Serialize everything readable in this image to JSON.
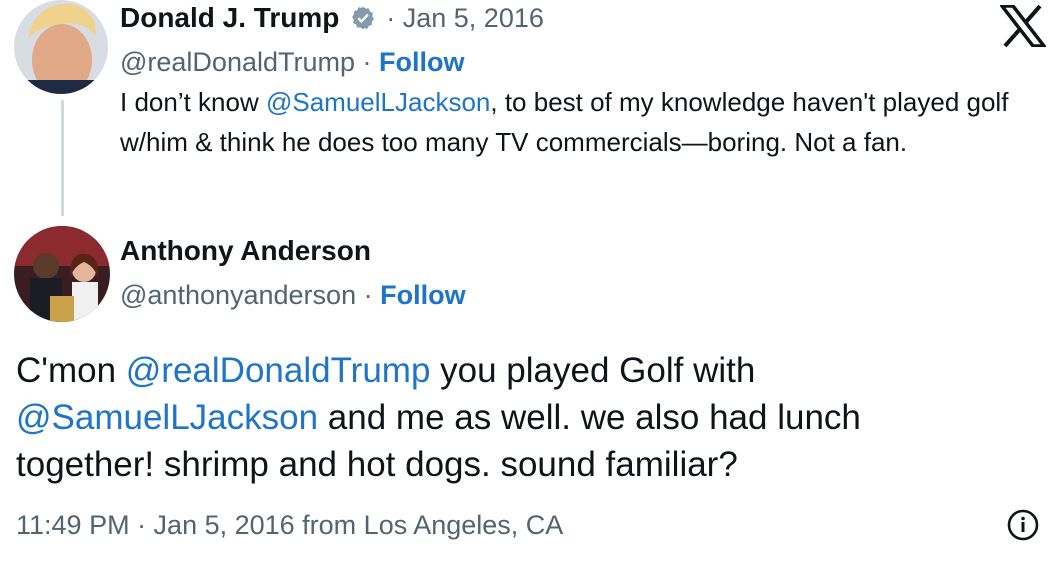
{
  "x_logo_icon": "x-logo-icon",
  "colors": {
    "accent": "#1d74c8",
    "muted": "#536471",
    "verified": "#829aab"
  },
  "parent": {
    "name": "Donald J. Trump",
    "date": "· Jan 5, 2016",
    "handle": "@realDonaldTrump",
    "sep": " · ",
    "follow": "Follow",
    "text_1": "I don’t know ",
    "mention_1": "@SamuelLJackson",
    "text_2": ", to best of my knowledge haven't played golf w/him & think he does too many TV commercials—boring. Not a fan."
  },
  "reply": {
    "name": "Anthony Anderson",
    "handle": "@anthonyanderson",
    "sep": " · ",
    "follow": "Follow",
    "text_1": "C'mon ",
    "mention_1": "@realDonaldTrump",
    "text_2": " you played Golf with ",
    "mention_2": "@SamuelLJackson",
    "text_3": " and me as well. we also had lunch together! shrimp and hot dogs. sound familiar?",
    "timestamp": "11:49 PM · Jan 5, 2016 from Los Angeles, CA"
  },
  "info_icon": "info-icon"
}
